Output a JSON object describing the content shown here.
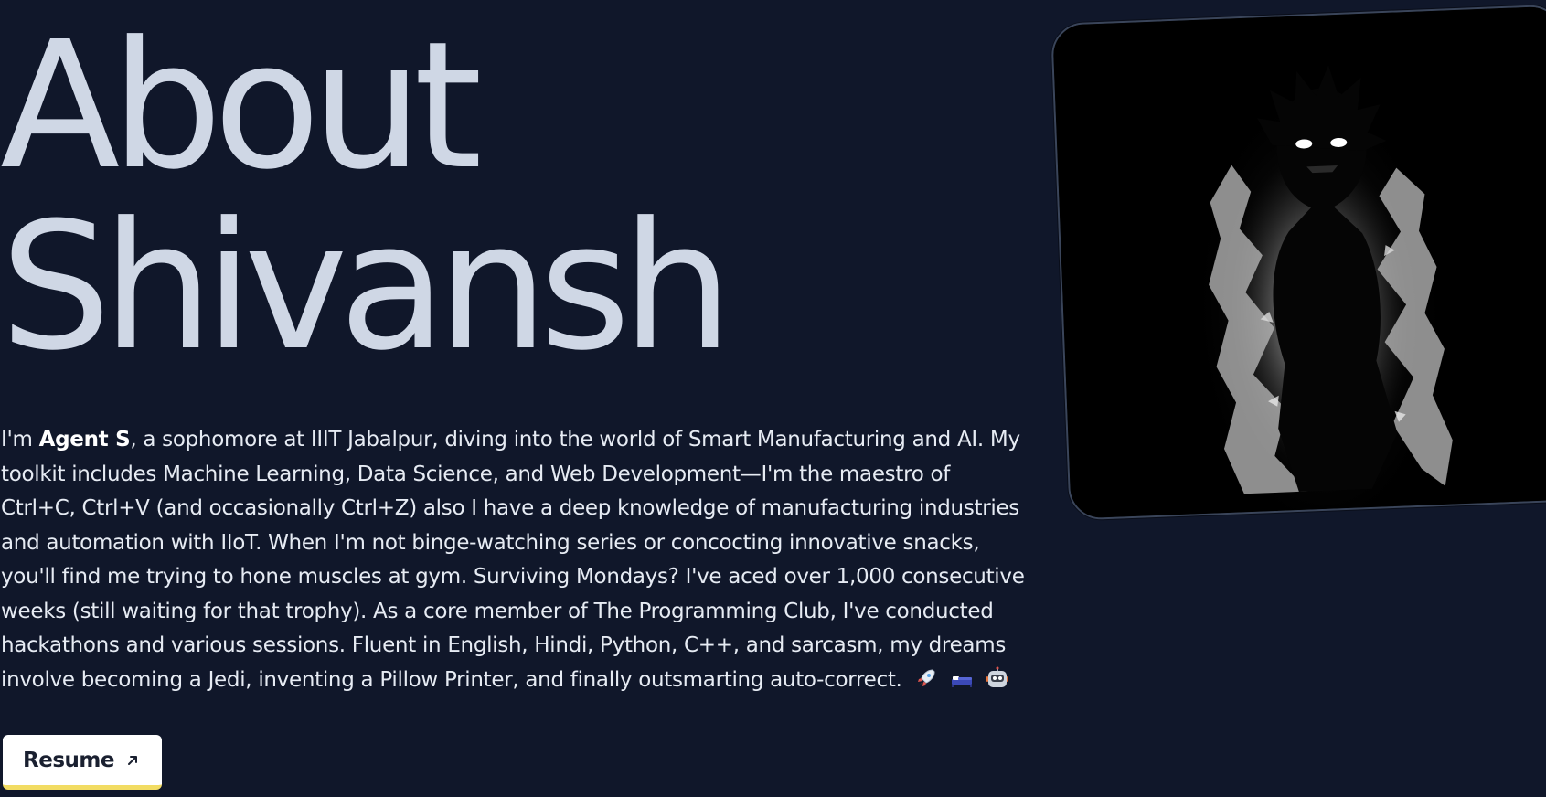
{
  "hero": {
    "title_line_1": "About",
    "title_line_2": "Shivansh"
  },
  "bio": {
    "intro": "I'm ",
    "name": "Agent S",
    "text": ", a sophomore at IIIT Jabalpur, diving into the world of Smart Manufacturing and AI. My toolkit includes Machine Learning, Data Science, and Web Development—I'm the maestro of Ctrl+C, Ctrl+V (and occasionally Ctrl+Z) also I have a deep knowledge of manufacturing industries and automation with IIoT. When I'm not binge-watching series or concocting innovative snacks, you'll find me trying to hone muscles at gym. Surviving Mondays? I've aced over 1,000 consecutive weeks (still waiting for that trophy). As a core member of The Programming Club, I've conducted hackathons and various sessions. Fluent in English, Hindi, Python, C++, and sarcasm, my dreams involve becoming a Jedi, inventing a Pillow Printer, and finally outsmarting auto-correct.",
    "emojis": [
      "rocket-icon",
      "bed-icon",
      "robot-icon"
    ]
  },
  "resume_button": {
    "label": "Resume",
    "icon": "arrow-up-right-icon"
  },
  "portrait": {
    "icon": "anime-character-portrait"
  },
  "colors": {
    "background": "#10172a",
    "title": "#cfd7e5",
    "text": "#e6ebf3",
    "button_bg": "#ffffff",
    "button_accent": "#f2dc63"
  }
}
